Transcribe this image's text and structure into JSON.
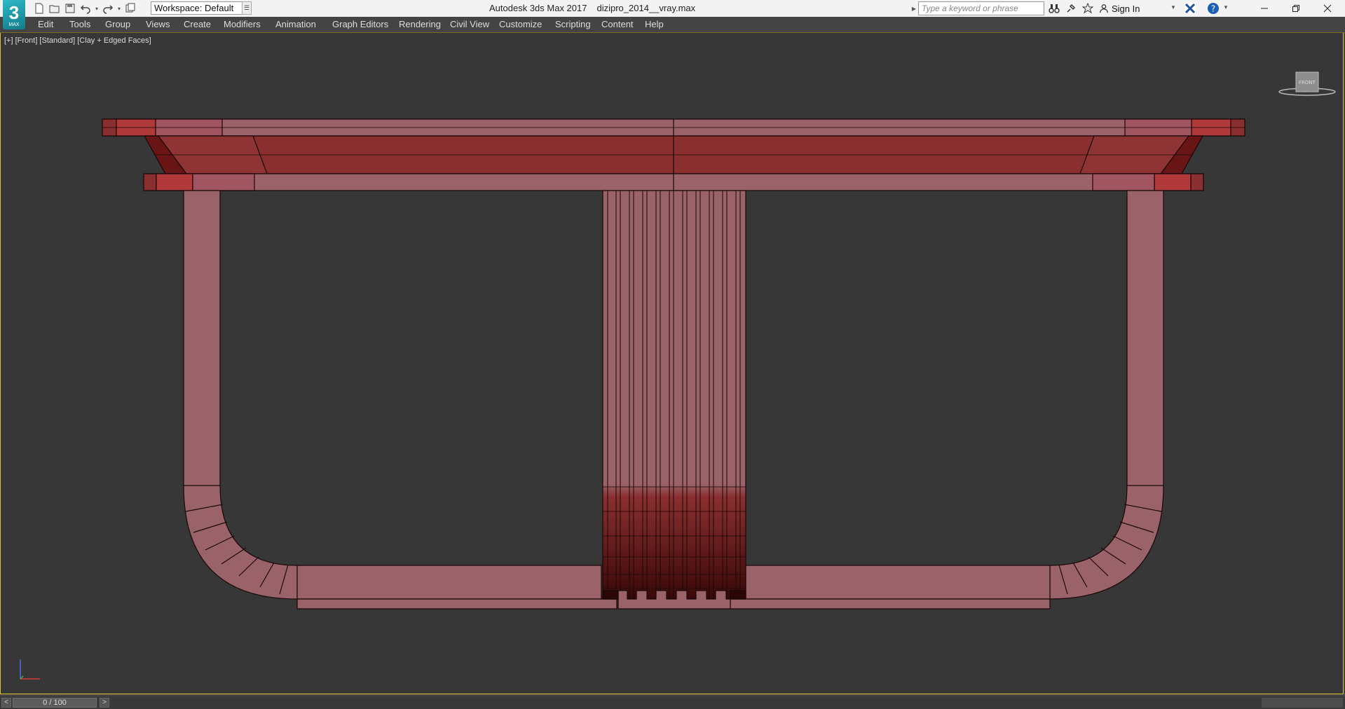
{
  "titlebar": {
    "app": "Autodesk 3ds Max 2017",
    "file": "dizipro_2014__vray.max",
    "logo": "3",
    "logo_sub": "MAX",
    "workspace_label": "Workspace: Default",
    "search_placeholder": "Type a keyword or phrase",
    "signin_label": "Sign In"
  },
  "menu": {
    "items": [
      "Edit",
      "Tools",
      "Group",
      "Views",
      "Create",
      "Modifiers",
      "Animation",
      "Graph Editors",
      "Rendering",
      "Civil View",
      "Customize",
      "Scripting",
      "Content",
      "Help"
    ]
  },
  "viewport": {
    "label": "[+] [Front] [Standard] [Clay + Edged Faces]",
    "viewcube_face": "FRONT",
    "colors": {
      "background": "#373737",
      "face_light": "#9a6269",
      "face_mid": "#8a2f2f",
      "face_dark": "#6a1515",
      "edge": "#1a0808"
    }
  },
  "timeline": {
    "frame_label": "0 / 100",
    "prev": "<",
    "next": ">"
  }
}
